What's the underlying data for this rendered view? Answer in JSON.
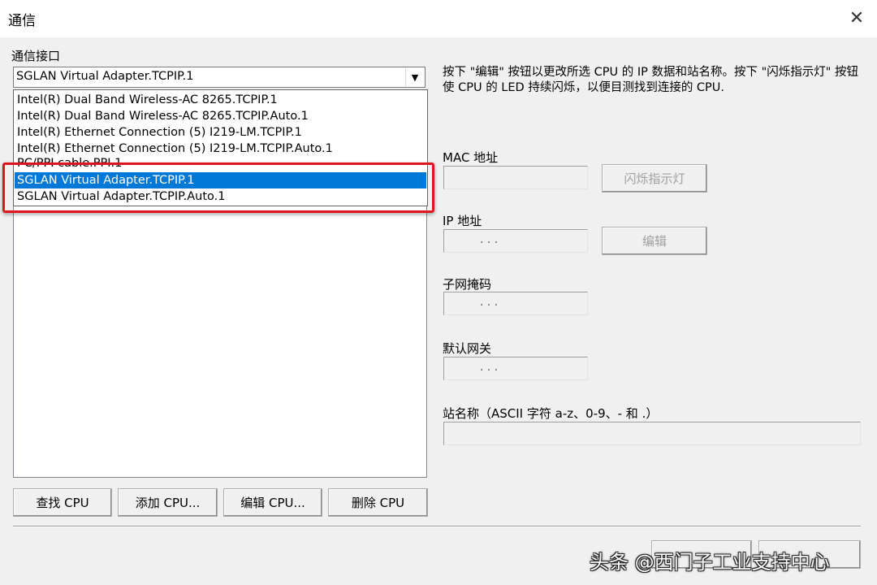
{
  "window": {
    "title": "通信",
    "close_glyph": "✕"
  },
  "interface": {
    "label": "通信接口",
    "selected": "SGLAN Virtual Adapter.TCPIP.1",
    "options": [
      "Intel(R) Dual Band Wireless-AC 8265.TCPIP.1",
      "Intel(R) Dual Band Wireless-AC 8265.TCPIP.Auto.1",
      "Intel(R) Ethernet Connection (5) I219-LM.TCPIP.1",
      "Intel(R) Ethernet Connection (5) I219-LM.TCPIP.Auto.1",
      "PC/PPI cable.PPI.1",
      "SGLAN Virtual Adapter.TCPIP.1",
      "SGLAN Virtual Adapter.TCPIP.Auto.1"
    ],
    "highlighted_index": 5
  },
  "description": "按下 \"编辑\" 按钮以更改所选 CPU 的 IP 数据和站名称。按下 \"闪烁指示灯\" 按钮使 CPU 的 LED 持续闪烁，以便目测找到连接的 CPU.",
  "mac": {
    "label": "MAC 地址",
    "value": "",
    "flash_button": "闪烁指示灯"
  },
  "ip": {
    "label": "IP 地址",
    "dots": ".     .     .",
    "edit_button": "编辑"
  },
  "subnet": {
    "label": "子网掩码",
    "dots": ".     .     ."
  },
  "gateway": {
    "label": "默认网关",
    "dots": ".     .     ."
  },
  "station": {
    "label": "站名称（ASCII 字符 a-z、0-9、- 和 .）",
    "value": ""
  },
  "buttons": {
    "find_cpu": "查找 CPU",
    "add_cpu": "添加 CPU...",
    "edit_cpu": "编辑 CPU...",
    "delete_cpu": "删除 CPU"
  },
  "watermark": "头条 @西门子工业支持中心",
  "colors": {
    "selection": "#0078d7",
    "highlight_box": "#e0141c"
  }
}
